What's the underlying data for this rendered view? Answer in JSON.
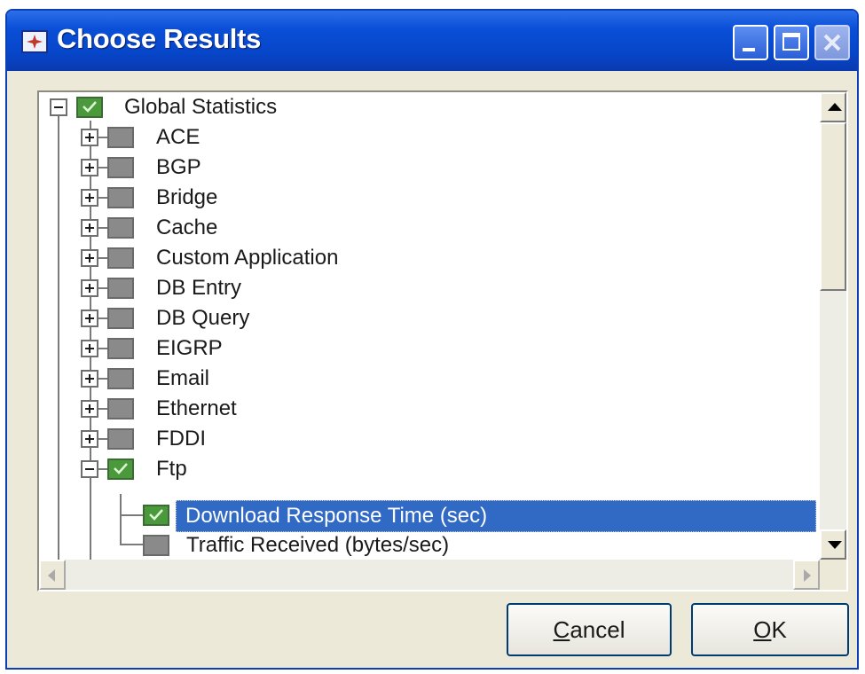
{
  "window": {
    "title": "Choose Results"
  },
  "tree": {
    "root_label": "Global Statistics",
    "items": [
      {
        "label": "ACE"
      },
      {
        "label": "BGP"
      },
      {
        "label": "Bridge"
      },
      {
        "label": "Cache"
      },
      {
        "label": "Custom Application"
      },
      {
        "label": "DB Entry"
      },
      {
        "label": "DB Query"
      },
      {
        "label": "EIGRP"
      },
      {
        "label": "Email"
      },
      {
        "label": "Ethernet"
      },
      {
        "label": "FDDI"
      },
      {
        "label": "Ftp"
      }
    ],
    "ftp_children": [
      {
        "label": "Download Response Time (sec)",
        "checked": true,
        "selected": true
      },
      {
        "label": "Traffic Received (bytes/sec)",
        "checked": false,
        "selected": false
      }
    ]
  },
  "buttons": {
    "cancel_mnemonic": "C",
    "cancel_rest": "ancel",
    "ok_mnemonic": "O",
    "ok_rest": "K"
  },
  "colors": {
    "title_bar": "#0a4fd8",
    "selection": "#316ac5",
    "checked_box": "#4a9a3c"
  }
}
